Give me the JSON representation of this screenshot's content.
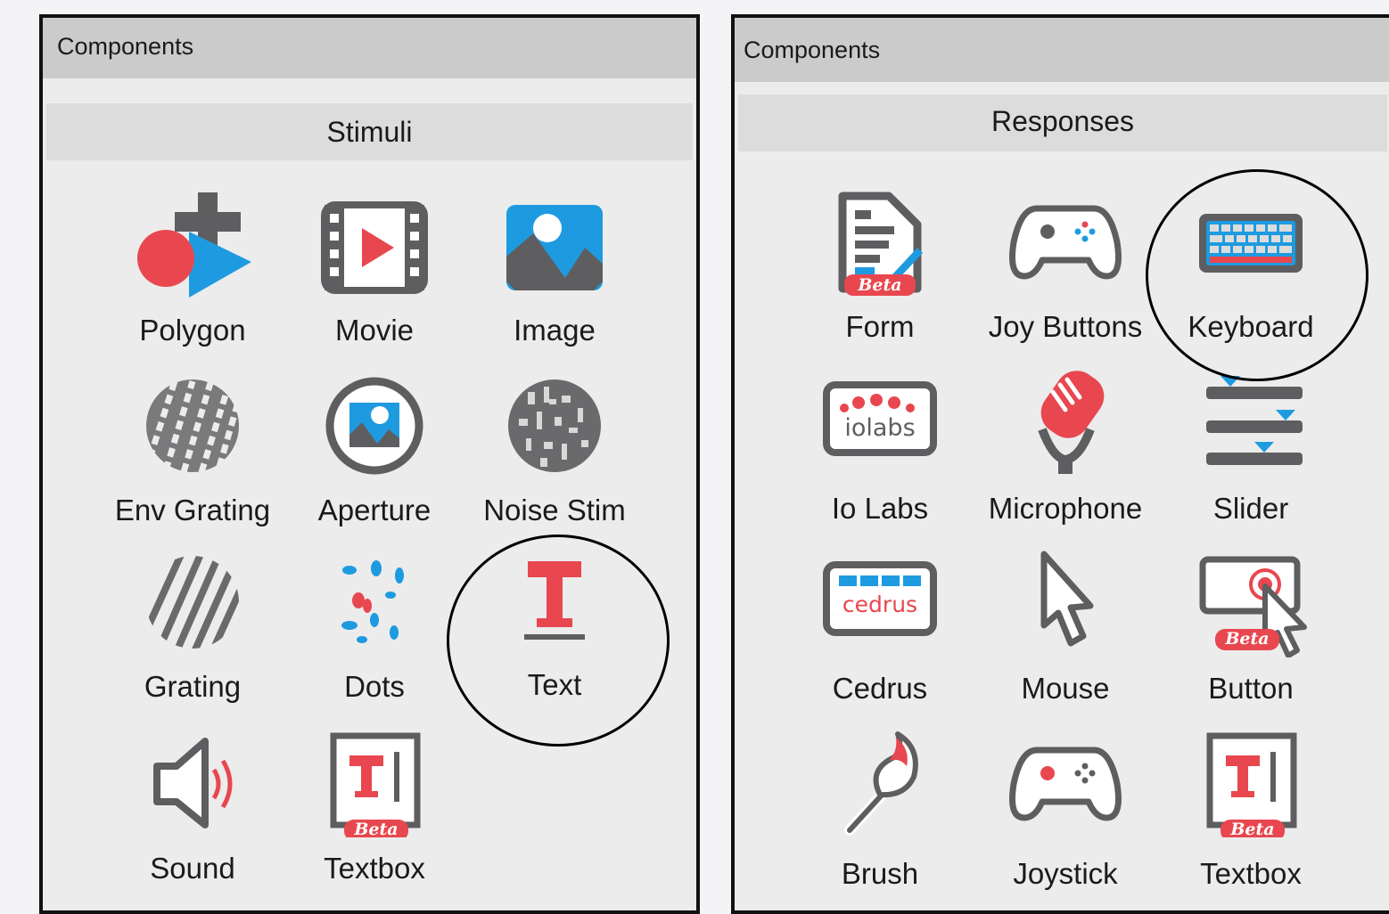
{
  "left_panel": {
    "title": "Components",
    "category": "Stimuli",
    "items": [
      {
        "label": "Polygon",
        "icon": "polygon-icon"
      },
      {
        "label": "Movie",
        "icon": "movie-icon"
      },
      {
        "label": "Image",
        "icon": "image-icon"
      },
      {
        "label": "Env Grating",
        "icon": "env-grating-icon"
      },
      {
        "label": "Aperture",
        "icon": "aperture-icon"
      },
      {
        "label": "Noise Stim",
        "icon": "noise-stim-icon"
      },
      {
        "label": "Grating",
        "icon": "grating-icon"
      },
      {
        "label": "Dots",
        "icon": "dots-icon"
      },
      {
        "label": "Text",
        "icon": "text-icon"
      },
      {
        "label": "Sound",
        "icon": "sound-icon"
      },
      {
        "label": "Textbox",
        "icon": "textbox-icon",
        "badge": "Beta"
      }
    ]
  },
  "right_panel": {
    "title": "Components",
    "category": "Responses",
    "items": [
      {
        "label": "Form",
        "icon": "form-icon",
        "badge": "Beta"
      },
      {
        "label": "Joy Buttons",
        "icon": "gamepad-icon"
      },
      {
        "label": "Keyboard",
        "icon": "keyboard-icon"
      },
      {
        "label": "Io Labs",
        "icon": "iolabs-icon",
        "logo_text": "iolabs"
      },
      {
        "label": "Microphone",
        "icon": "microphone-icon"
      },
      {
        "label": "Slider",
        "icon": "slider-icon"
      },
      {
        "label": "Cedrus",
        "icon": "cedrus-icon",
        "logo_text": "cedrus"
      },
      {
        "label": "Mouse",
        "icon": "mouse-cursor-icon"
      },
      {
        "label": "Button",
        "icon": "button-icon",
        "badge": "Beta"
      },
      {
        "label": "Brush",
        "icon": "brush-icon"
      },
      {
        "label": "Joystick",
        "icon": "joystick-icon"
      },
      {
        "label": "Textbox",
        "icon": "textbox-icon",
        "badge": "Beta"
      }
    ]
  },
  "colors": {
    "accent_red": "#e8474f",
    "icon_gray": "#5e5e60",
    "accent_blue": "#1e9be0",
    "panel_bg": "#ececec",
    "titlebar_bg": "#cbcbcb"
  }
}
